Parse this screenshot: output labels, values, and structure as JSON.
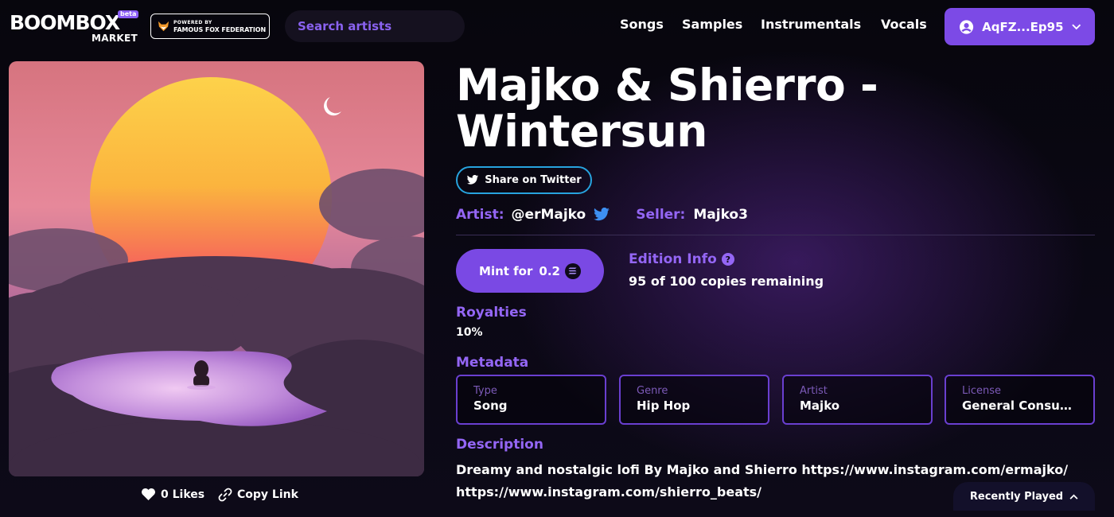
{
  "header": {
    "logo_main": "BOOMBOX",
    "logo_beta": "beta",
    "logo_sub": "MARKET",
    "powered_small": "POWERED BY",
    "powered_big": "FAMOUS FOX FEDERATION",
    "search_placeholder": "Search artists",
    "nav": [
      "Songs",
      "Samples",
      "Instrumentals",
      "Vocals"
    ],
    "wallet_label": "AqFZ...Ep95"
  },
  "album": {
    "likes_label": "0 Likes",
    "copy_link_label": "Copy Link"
  },
  "track": {
    "title": "Majko & Shierro - Wintersun",
    "share_twitter_label": "Share on Twitter",
    "artist_label": "Artist:",
    "artist_value": "@erMajko",
    "seller_label": "Seller:",
    "seller_value": "Majko3",
    "mint_label": "Mint for",
    "mint_price": "0.2",
    "edition_label": "Edition Info",
    "edition_value": "95 of 100 copies remaining",
    "royalties_label": "Royalties",
    "royalties_value": "10%",
    "metadata_label": "Metadata",
    "metadata": [
      {
        "key": "Type",
        "value": "Song"
      },
      {
        "key": "Genre",
        "value": "Hip Hop"
      },
      {
        "key": "Artist",
        "value": "Majko"
      },
      {
        "key": "License",
        "value": "General Consumer"
      }
    ],
    "description_label": "Description",
    "description_value": "Dreamy and nostalgic lofi By Majko and Shierro https://www.instagram.com/ermajko/ https://www.instagram.com/shierro_beats/"
  },
  "footer": {
    "recently_played_label": "Recently Played"
  },
  "colors": {
    "accent": "#7c4ae6",
    "label_purple": "#9466f5",
    "twitter_blue": "#27a3de"
  }
}
